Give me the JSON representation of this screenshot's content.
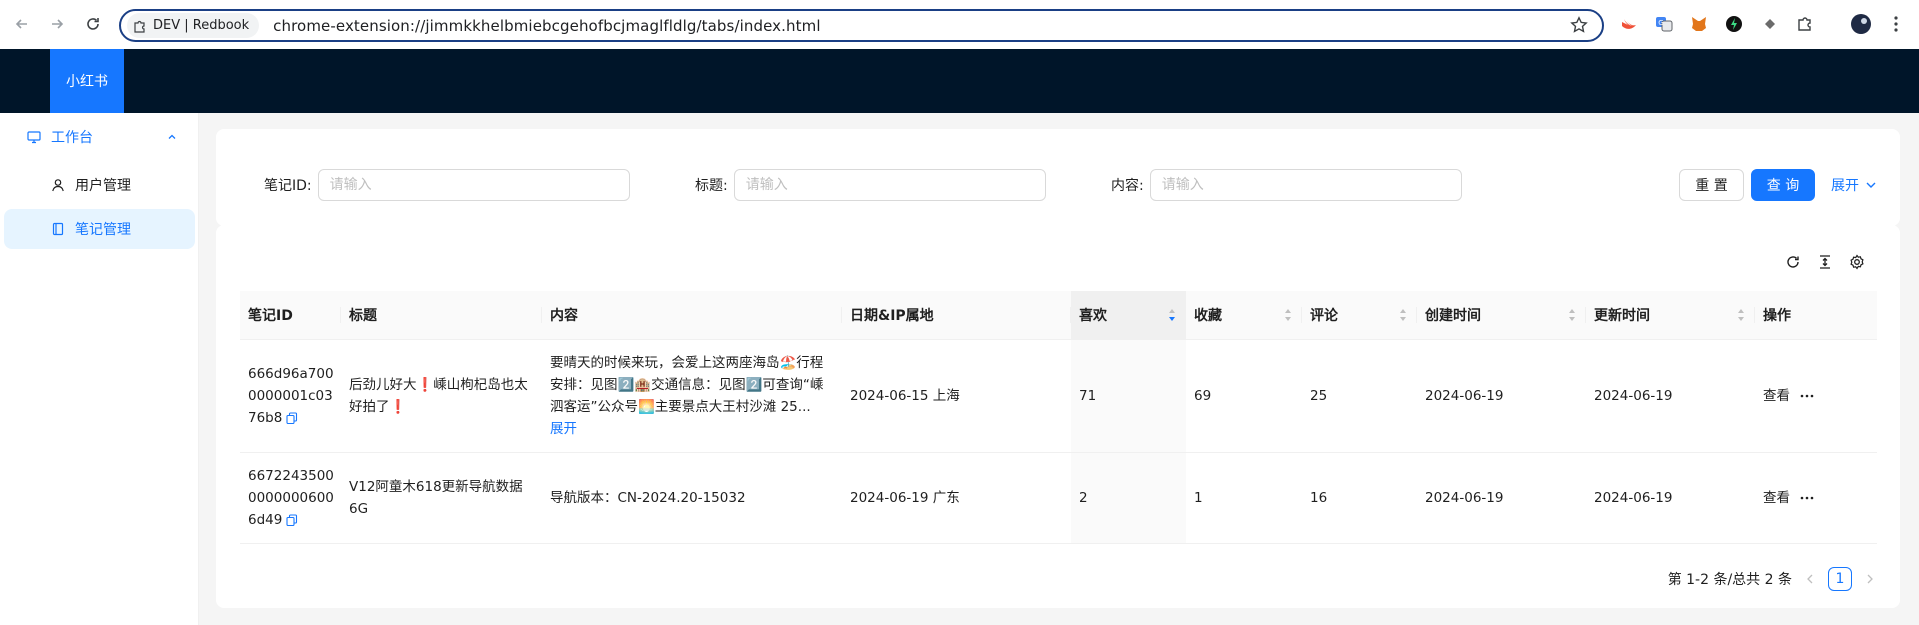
{
  "browser": {
    "tab_label": "DEV | Redbook",
    "url": "chrome-extension://jimmkkhelbmiebcgehofbcjmaglfldlg/tabs/index.html"
  },
  "app": {
    "brand": "小红书"
  },
  "sidebar": {
    "group_label": "工作台",
    "items": [
      {
        "label": "用户管理",
        "icon": "user-icon"
      },
      {
        "label": "笔记管理",
        "icon": "book-icon",
        "active": true
      }
    ]
  },
  "search": {
    "fields": [
      {
        "label": "笔记ID:",
        "placeholder": "请输入"
      },
      {
        "label": "标题:",
        "placeholder": "请输入"
      },
      {
        "label": "内容:",
        "placeholder": "请输入"
      }
    ],
    "reset_label": "重 置",
    "query_label": "查 询",
    "expand_label": "展开"
  },
  "table": {
    "columns": [
      "笔记ID",
      "标题",
      "内容",
      "日期&IP属地",
      "喜欢",
      "收藏",
      "评论",
      "创建时间",
      "更新时间",
      "操作"
    ],
    "rows": [
      {
        "id": "666d96a7000000001c0376b8",
        "title": "后劲儿好大❗️嵊山枸杞岛也太好拍了❗️",
        "content": "要晴天的时候来玩，会爱上这两座海岛🏖️行程安排：见图2️⃣🏨交通信息：见图2️⃣可查询“嵊泗客运”公众号🌅主要景点大王村沙滩 25...",
        "content_more": "展开",
        "date_ip": "2024-06-15 上海",
        "likes": "71",
        "collects": "69",
        "comments": "25",
        "created": "2024-06-19",
        "updated": "2024-06-19",
        "action": "查看"
      },
      {
        "id": "667224350000000006006d49",
        "title": "V12阿童木618更新导航数据6G",
        "content": "导航版本：CN-2024.20-15032",
        "content_more": "",
        "date_ip": "2024-06-19 广东",
        "likes": "2",
        "collects": "1",
        "comments": "16",
        "created": "2024-06-19",
        "updated": "2024-06-19",
        "action": "查看"
      }
    ]
  },
  "pagination": {
    "summary": "第 1-2 条/总共 2 条",
    "current_page": "1"
  },
  "colors": {
    "primary": "#1677ff",
    "header_bg": "#001529",
    "omnibox_border": "#1a3f85"
  }
}
